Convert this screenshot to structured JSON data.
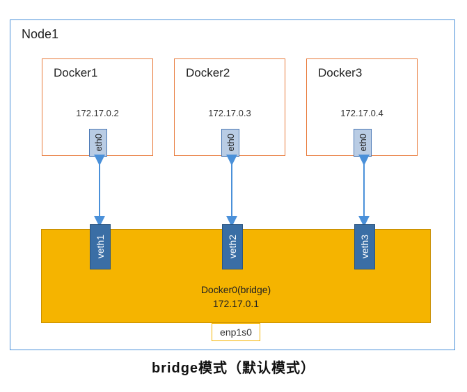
{
  "node": {
    "title": "Node1"
  },
  "dockers": {
    "d1": {
      "title": "Docker1",
      "ip": "172.17.0.2",
      "iface": "eth0"
    },
    "d2": {
      "title": "Docker2",
      "ip": "172.17.0.3",
      "iface": "eth0"
    },
    "d3": {
      "title": "Docker3",
      "ip": "172.17.0.4",
      "iface": "eth0"
    }
  },
  "bridge": {
    "label1": "Docker0(bridge)",
    "label2": "172.17.0.1",
    "veths": {
      "v1": "veth1",
      "v2": "veth2",
      "v3": "veth3"
    },
    "nic": "enp1s0"
  },
  "caption": "bridge模式（默认模式）",
  "chart_data": {
    "type": "diagram",
    "title": "bridge模式（默认模式）",
    "host": "Node1",
    "bridge": {
      "name": "Docker0(bridge)",
      "ip": "172.17.0.1",
      "physical_nic": "enp1s0"
    },
    "containers": [
      {
        "name": "Docker1",
        "ip": "172.17.0.2",
        "iface": "eth0",
        "veth": "veth1"
      },
      {
        "name": "Docker2",
        "ip": "172.17.0.3",
        "iface": "eth0",
        "veth": "veth2"
      },
      {
        "name": "Docker3",
        "ip": "172.17.0.4",
        "iface": "eth0",
        "veth": "veth3"
      }
    ],
    "links": [
      {
        "from": "Docker1.eth0",
        "to": "veth1",
        "bidirectional": true
      },
      {
        "from": "Docker2.eth0",
        "to": "veth2",
        "bidirectional": true
      },
      {
        "from": "Docker3.eth0",
        "to": "veth3",
        "bidirectional": true
      }
    ]
  }
}
